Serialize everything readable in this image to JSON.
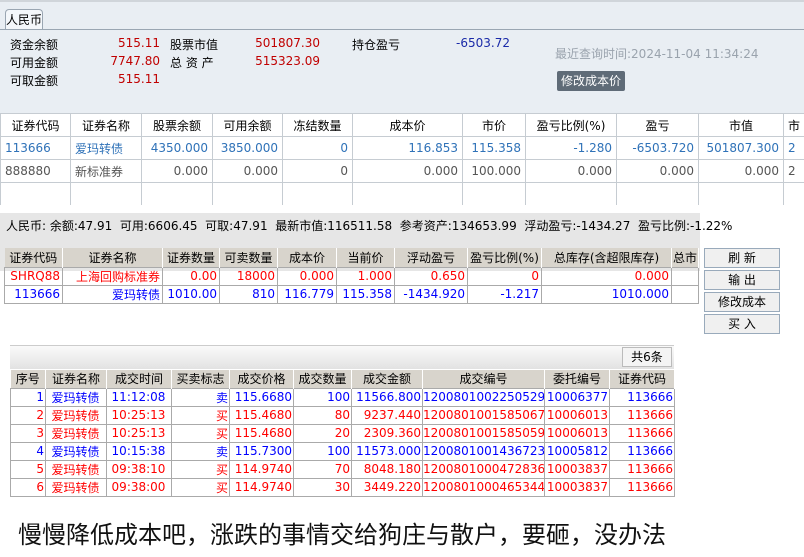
{
  "panel1": {
    "tab": "人民币",
    "summary": [
      {
        "label": "资金余额",
        "value": "515.11"
      },
      {
        "label": "可用金额",
        "value": "7747.80"
      },
      {
        "label": "可取金额",
        "value": "515.11"
      },
      {
        "label": "股票市值",
        "value": "501807.30"
      },
      {
        "label": "总 资 产",
        "value": "515323.09"
      },
      {
        "label": "持仓盈亏",
        "value": "-6503.72"
      }
    ],
    "query_time": "最近查询时间:2024-11-04 11:34:24",
    "edit_cost_button": "修改成本价",
    "columns": [
      "证券代码",
      "证券名称",
      "股票余额",
      "可用余额",
      "冻结数量",
      "成本价",
      "市价",
      "盈亏比例(%)",
      "盈亏",
      "市值",
      "市"
    ],
    "rows": [
      [
        "113666",
        "爱玛转债",
        "4350.000",
        "3850.000",
        "0",
        "116.853",
        "115.358",
        "-1.280",
        "-6503.720",
        "501807.300",
        "2"
      ],
      [
        "888880",
        "新标准券",
        "0.000",
        "0.000",
        "0",
        "0.000",
        "100.000",
        "0.000",
        "0.000",
        "0.000",
        "2"
      ]
    ]
  },
  "panel2": {
    "summary": "人民币: 余额:47.91  可用:6606.45  可取:47.91  最新市值:116511.58  参考资产:134653.99  浮动盈亏:-1434.27  盈亏比例:-1.22%",
    "columns": [
      "证券代码",
      "证券名称",
      "证券数量",
      "可卖数量",
      "成本价",
      "当前价",
      "浮动盈亏",
      "盈亏比例(%)",
      "总库存(含超限库存)",
      "总市"
    ],
    "rows": [
      [
        "SHRQ88",
        "上海回购标准券",
        "0.00",
        "18000",
        "0.000",
        "1.000",
        "0.650",
        "0",
        "0.000",
        ""
      ],
      [
        "113666",
        "爱玛转债",
        "1010.00",
        "810",
        "116.779",
        "115.358",
        "-1434.920",
        "-1.217",
        "1010.000",
        ""
      ]
    ],
    "buttons": [
      "刷 新",
      "输 出",
      "修改成本",
      "买 入"
    ],
    "colors": {
      "row0": "#ff0000",
      "row1": "#0000ff"
    }
  },
  "panel3": {
    "count": "共6条",
    "columns": [
      "序号",
      "证券名称",
      "成交时间",
      "买卖标志",
      "成交价格",
      "成交数量",
      "成交金额",
      "成交编号",
      "委托编号",
      "证券代码"
    ],
    "rows": [
      [
        "1",
        "爱玛转债",
        "11:12:08",
        "卖",
        "115.6680",
        "100",
        "11566.800",
        "1200801002250529",
        "10006377",
        "113666"
      ],
      [
        "2",
        "爱玛转债",
        "10:25:13",
        "买",
        "115.4680",
        "80",
        "9237.440",
        "1200801001585067",
        "10006013",
        "113666"
      ],
      [
        "3",
        "爱玛转债",
        "10:25:13",
        "买",
        "115.4680",
        "20",
        "2309.360",
        "1200801001585059",
        "10006013",
        "113666"
      ],
      [
        "4",
        "爱玛转债",
        "10:15:38",
        "卖",
        "115.7300",
        "100",
        "11573.000",
        "1200801001436723",
        "10005812",
        "113666"
      ],
      [
        "5",
        "爱玛转债",
        "09:38:10",
        "买",
        "114.9740",
        "70",
        "8048.180",
        "1200801000472836",
        "10003837",
        "113666"
      ],
      [
        "6",
        "爱玛转债",
        "09:38:00",
        "买",
        "114.9740",
        "30",
        "3449.220",
        "1200801000465344",
        "10003837",
        "113666"
      ]
    ]
  },
  "caption": "慢慢降低成本吧，涨跌的事情交给狗庄与散户，要砸，没办法"
}
